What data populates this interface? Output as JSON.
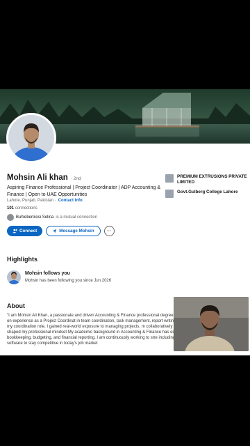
{
  "profile": {
    "name": "Mohsin Ali khan",
    "degree": "· 2nd",
    "headline": "Aspiring Finance Professional | Project Coordinator | ADP Accounting & Finance | Open to UAE Opportunities",
    "location": "Lahore, Punjab, Pakistan ·",
    "contact_label": "Contact info",
    "connections_count": "101",
    "connections_label": "connections",
    "mutual_name": "Buhlebenkosi Selina",
    "mutual_suffix": "is a mutual connection"
  },
  "actions": {
    "connect": "Connect",
    "message": "Message Mohsin",
    "more": "···"
  },
  "side": {
    "company": "PREMIUM EXTRUSIONS PRIVATE LIMITED",
    "school": "Govt.Gulberg College Lahore"
  },
  "highlights": {
    "title": "Highlights",
    "item_title": "Mohsin follows you",
    "item_sub": "Mohsin has been following you since Jun 2026"
  },
  "about": {
    "title": "About",
    "text": "\"I am Mohsin Ali Khan, a passionate and driven Accounting & Finance professional degree in Accounting & Finance. With hands-on experience as a Project Coordinat in team coordination, task management, report writing, and professional communi During my coordination role, I gained real-world exposure to managing projects, m collaboratively with teams — experience that has shaped my professional mindset My academic background in Accounting & Finance has equipped me with a solid fo bookkeeping, budgeting, and financial reporting. I am continuously working to stre including Microsoft Excel and accounting software to stay competitive in today's job market"
  },
  "colors": {
    "accent": "#0a66c2",
    "page_bg": "#f3f2ef",
    "text": "#191919"
  },
  "icons": [
    "send-icon",
    "person-add-icon",
    "more-icon",
    "company-logo-icon",
    "school-logo-icon"
  ]
}
